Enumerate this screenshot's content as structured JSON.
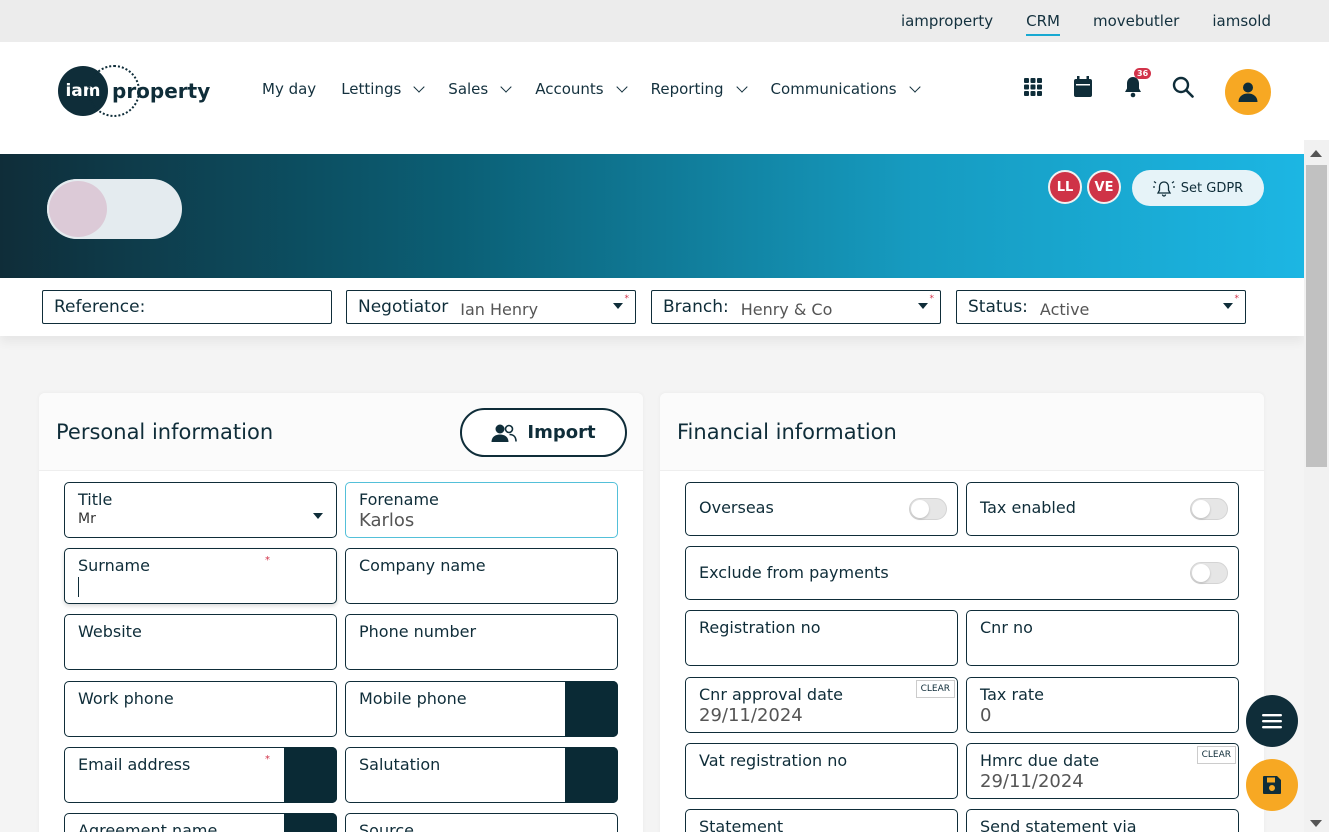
{
  "topbar": {
    "links": [
      "iamproperty",
      "CRM",
      "movebutler",
      "iamsold"
    ]
  },
  "logo": {
    "circle_text": "iam",
    "word": "property"
  },
  "nav": {
    "items": [
      "My day",
      "Lettings",
      "Sales",
      "Accounts",
      "Reporting",
      "Communications"
    ]
  },
  "notifications": {
    "count": "36"
  },
  "banner": {
    "chips": [
      "LL",
      "VE"
    ],
    "gdpr_label": "Set GDPR"
  },
  "filters": {
    "reference_label": "Reference:",
    "negotiator_label": "Negotiator",
    "negotiator_value": "Ian Henry",
    "branch_label": "Branch:",
    "branch_value": "Henry & Co",
    "status_label": "Status:",
    "status_value": "Active"
  },
  "personal": {
    "title": "Personal information",
    "import_label": "Import",
    "fields": {
      "title_label": "Title",
      "title_value": "Mr",
      "forename_label": "Forename",
      "forename_value": "Karlos",
      "surname_label": "Surname",
      "company_label": "Company name",
      "website_label": "Website",
      "phone_label": "Phone number",
      "work_phone_label": "Work phone",
      "mobile_label": "Mobile phone",
      "email_label": "Email address",
      "salutation_label": "Salutation",
      "agreement_label": "Agreement name",
      "source_label": "Source"
    }
  },
  "financial": {
    "title": "Financial information",
    "fields": {
      "overseas_label": "Overseas",
      "tax_enabled_label": "Tax enabled",
      "exclude_label": "Exclude from payments",
      "registration_label": "Registration no",
      "cnr_label": "Cnr no",
      "cnr_date_label": "Cnr approval date",
      "cnr_date_value": "29/11/2024",
      "tax_rate_label": "Tax rate",
      "tax_rate_value": "0",
      "vat_label": "Vat registration no",
      "hmrc_label": "Hmrc due date",
      "hmrc_value": "29/11/2024",
      "statement_label": "Statement",
      "send_statement_label": "Send statement via",
      "clear_label": "CLEAR"
    }
  },
  "colors": {
    "primary": "#0f2d39",
    "accent": "#f7a823",
    "badge": "#d2334a",
    "link_underline": "#18a9d2"
  }
}
